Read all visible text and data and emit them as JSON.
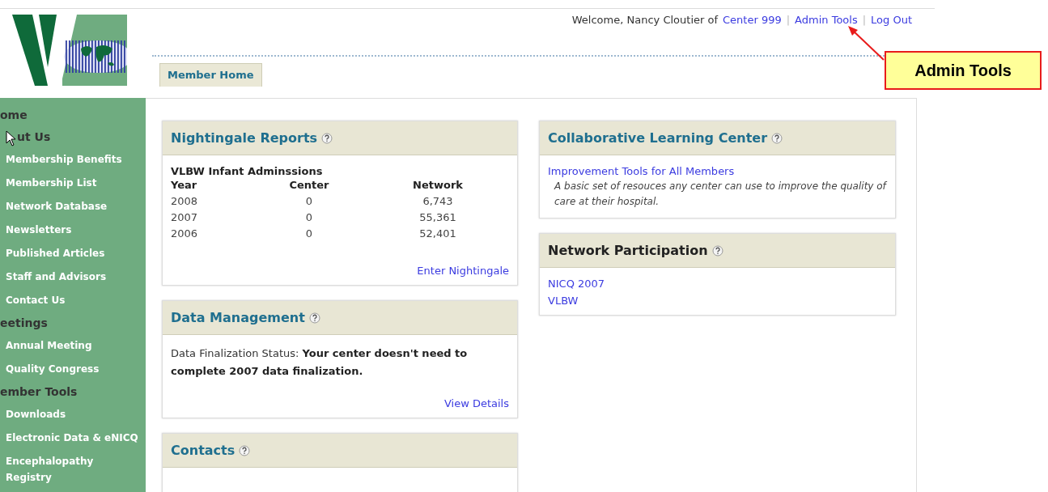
{
  "header": {
    "welcome": "Welcome, Nancy Cloutier of",
    "links": [
      "Center 999",
      "Admin Tools",
      "Log Out"
    ],
    "separators": [
      "|",
      "|"
    ]
  },
  "tabs": [
    {
      "label": "Member Home",
      "selected": true
    }
  ],
  "sidebar": {
    "items": [
      {
        "kind": "section",
        "label": "ome"
      },
      {
        "kind": "section",
        "label": "ut Us"
      },
      {
        "kind": "link",
        "label": "Membership Benefits"
      },
      {
        "kind": "link",
        "label": "Membership List"
      },
      {
        "kind": "link",
        "label": "Network Database"
      },
      {
        "kind": "link",
        "label": "Newsletters"
      },
      {
        "kind": "link",
        "label": "Published Articles"
      },
      {
        "kind": "link",
        "label": "Staff and Advisors"
      },
      {
        "kind": "link",
        "label": "Contact Us"
      },
      {
        "kind": "section",
        "label": "eetings"
      },
      {
        "kind": "link",
        "label": "Annual Meeting"
      },
      {
        "kind": "link",
        "label": "Quality Congress"
      },
      {
        "kind": "section",
        "label": "ember Tools"
      },
      {
        "kind": "link",
        "label": "Downloads"
      },
      {
        "kind": "link",
        "label": "Electronic Data & eNICQ"
      },
      {
        "kind": "link",
        "label": "Encephalopathy Registry"
      }
    ]
  },
  "left_column": [
    {
      "kind": "stats",
      "title": "Nightingale Reports",
      "highlighted": false,
      "subtitle": "VLBW Infant Adminssions",
      "columns": [
        "Year",
        "Center",
        "Network"
      ],
      "rows": [
        [
          "2008",
          "0",
          "6,743"
        ],
        [
          "2007",
          "0",
          "55,361"
        ],
        [
          "2006",
          "0",
          "52,401"
        ]
      ],
      "link": "Enter Nightingale"
    },
    {
      "kind": "status",
      "title": "Data Management",
      "highlighted": false,
      "text": "Data Finalization Status: **Your center doesn't need to complete 2007 data finalization.**",
      "link": "View Details"
    },
    {
      "kind": "empty",
      "title": "Contacts",
      "highlighted": false
    }
  ],
  "right_column": [
    {
      "kind": "resources",
      "title": "Collaborative Learning Center",
      "highlighted": false,
      "link": "Improvement Tools for All Members",
      "description": "A basic set of resouces any center can use to improve the quality of care at their hospital."
    },
    {
      "kind": "links",
      "title": "Network Participation",
      "highlighted": true,
      "links": [
        "NICQ 2007",
        "VLBW"
      ]
    }
  ],
  "callout": {
    "label": "Admin Tools"
  }
}
